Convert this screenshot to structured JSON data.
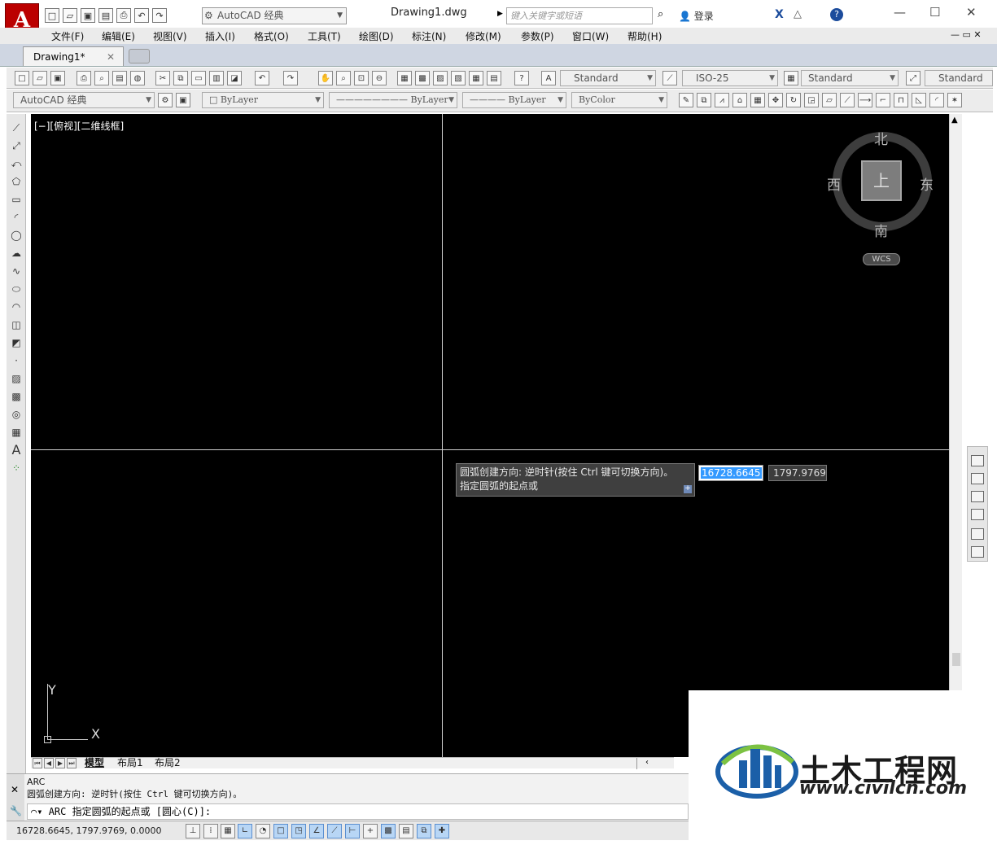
{
  "app": {
    "document_title": "Drawing1.dwg",
    "workspace": "AutoCAD 经典",
    "search_placeholder": "键入关键字或短语",
    "login_label": "登录"
  },
  "menu": [
    "文件(F)",
    "编辑(E)",
    "视图(V)",
    "插入(I)",
    "格式(O)",
    "工具(T)",
    "绘图(D)",
    "标注(N)",
    "修改(M)",
    "参数(P)",
    "窗口(W)",
    "帮助(H)"
  ],
  "tabs": {
    "drawing": "Drawing1*"
  },
  "toolbar": {
    "text_style": "Standard",
    "dim_style": "ISO-25",
    "table_style": "Standard",
    "multileader_style": "Standard",
    "workspace": "AutoCAD 经典",
    "layer": "ByLayer",
    "linetype": "ByLayer",
    "lineweight": "ByLayer",
    "plot_style": "ByColor"
  },
  "viewport": {
    "label": "[−][俯视][二维线框]"
  },
  "viewcube": {
    "north": "北",
    "south": "南",
    "east": "东",
    "west": "西",
    "face": "上",
    "wcs": "WCS"
  },
  "prompt": {
    "line1": "圆弧创建方向: 逆时针(按住 Ctrl 键可切换方向)。",
    "line2": "指定圆弧的起点或",
    "input_x": "16728.6645",
    "input_y": "1797.9769"
  },
  "ucs": {
    "x": "X",
    "y": "Y"
  },
  "layout_tabs": [
    "模型",
    "布局1",
    "布局2"
  ],
  "command": {
    "history1": "ARC",
    "history2": "圆弧创建方向: 逆时针(按住 Ctrl 键可切换方向)。",
    "current": "ARC 指定圆弧的起点或 [圆心(C)]:"
  },
  "status": {
    "coordinates": "16728.6645, 1797.9769, 0.0000"
  },
  "watermark": {
    "brand": "土木工程网",
    "url": "www.civilcn.com"
  }
}
